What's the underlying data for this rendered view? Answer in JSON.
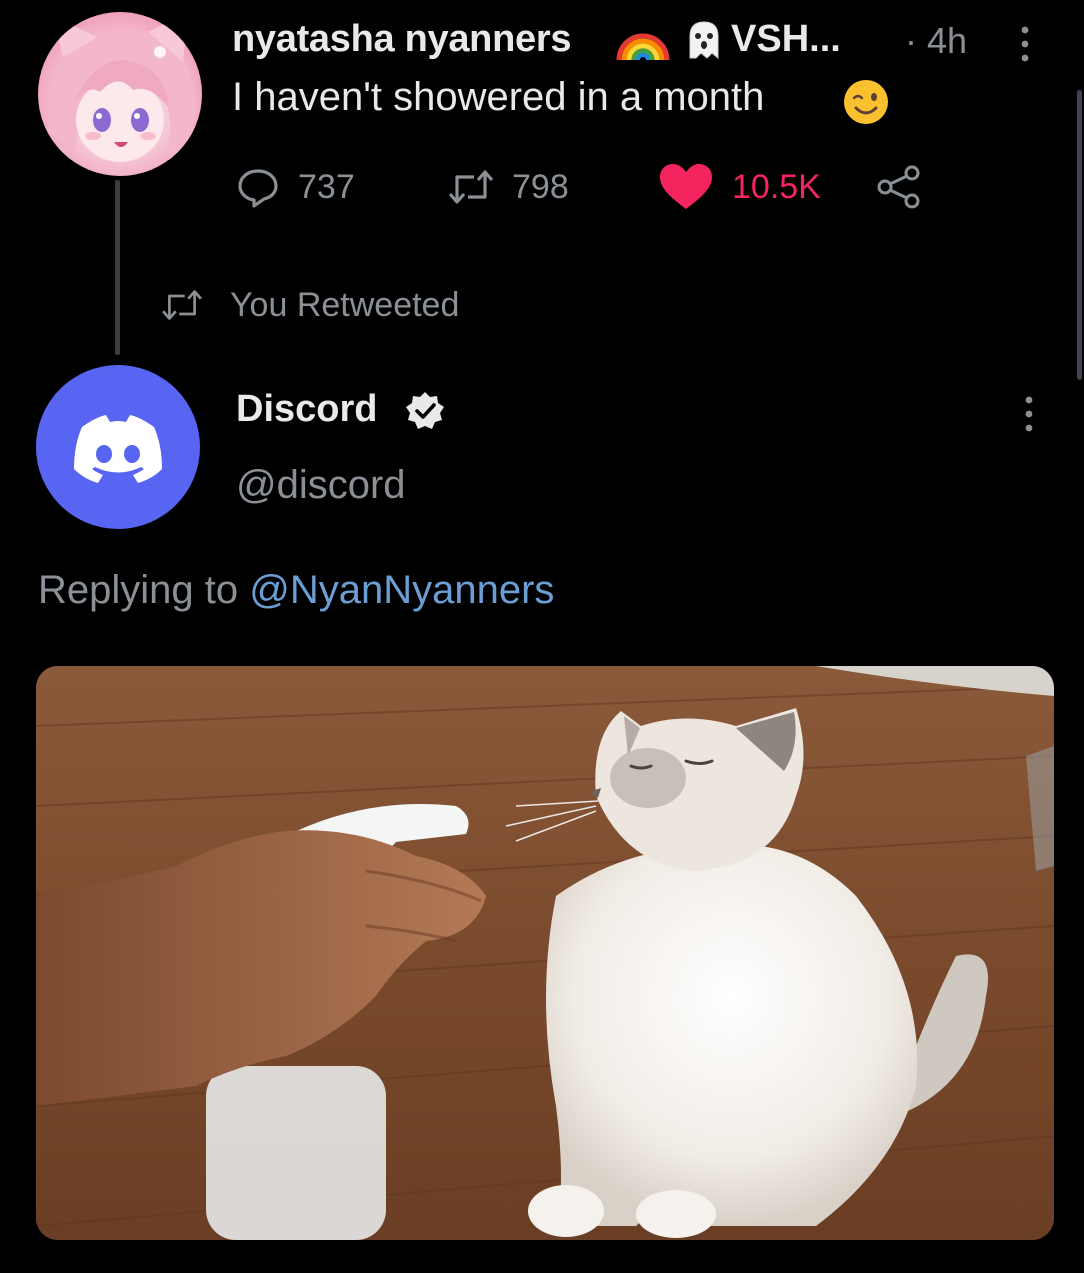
{
  "tweet1": {
    "display_name": "nyatasha nyanners",
    "name_suffix": "VSH...",
    "time": "· 4h",
    "text": "I haven't showered in a month",
    "emoji_icons": [
      "rainbow-icon",
      "ghost-icon",
      "winking-face-icon"
    ],
    "actions": {
      "replies": "737",
      "retweets": "798",
      "likes": "10.5K"
    },
    "like_color": "#f4245e"
  },
  "retweet_banner": {
    "label": "You Retweeted"
  },
  "tweet2": {
    "display_name": "Discord",
    "handle": "@discord",
    "verified": true,
    "avatar_color": "#5865f2",
    "replying_prefix": "Replying to",
    "replying_to": "@NyanNyanners",
    "mention_color": "#6a9ed4"
  }
}
